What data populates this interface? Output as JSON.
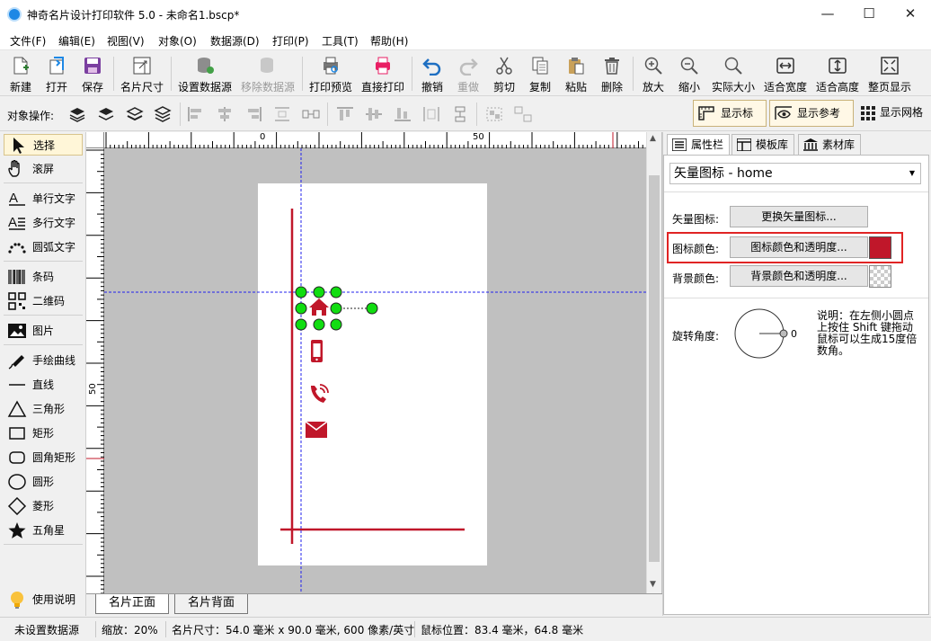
{
  "window": {
    "title": "神奇名片设计打印软件 5.0 - 未命名1.bscp*",
    "minimize": "—",
    "maximize": "☐",
    "close": "✕"
  },
  "menu": [
    "文件(F)",
    "编辑(E)",
    "视图(V)",
    "对象(O)",
    "数据源(D)",
    "打印(P)",
    "工具(T)",
    "帮助(H)"
  ],
  "toolbar": {
    "new": "新建",
    "open": "打开",
    "save": "保存",
    "card_size": "名片尺寸",
    "set_datasource": "设置数据源",
    "remove_datasource": "移除数据源",
    "print_preview": "打印预览",
    "direct_print": "直接打印",
    "undo": "撤销",
    "redo": "重做",
    "cut": "剪切",
    "copy": "复制",
    "paste": "粘贴",
    "delete": "删除",
    "zoom_in": "放大",
    "zoom_out": "缩小",
    "actual_size": "实际大小",
    "fit_width": "适合宽度",
    "fit_height": "适合高度",
    "full_page": "整页显示"
  },
  "objbar": {
    "label": "对象操作:",
    "show_ruler": "显示标尺",
    "show_guides": "显示参考线",
    "show_grid": "显示网格"
  },
  "tools": {
    "select": "选择",
    "pan": "滚屏",
    "single_text": "单行文字",
    "multi_text": "多行文字",
    "arc_text": "圆弧文字",
    "barcode": "条码",
    "qrcode": "二维码",
    "image": "图片",
    "freehand": "手绘曲线",
    "line": "直线",
    "triangle": "三角形",
    "rectangle": "矩形",
    "rounded_rect": "圆角矩形",
    "ellipse": "圆形",
    "diamond": "菱形",
    "star": "五角星",
    "help": "使用说明"
  },
  "ruler": {
    "h0": "0",
    "h50": "50",
    "v50": "50"
  },
  "page_tabs": {
    "front": "名片正面",
    "back": "名片背面"
  },
  "right_tabs": {
    "properties": "属性栏",
    "templates": "模板库",
    "materials": "素材库"
  },
  "properties": {
    "object_select": "矢量图标 - home",
    "vector_icon_label": "矢量图标:",
    "vector_icon_button": "更换矢量图标...",
    "icon_color_label": "图标颜色:",
    "icon_color_button": "图标颜色和透明度...",
    "icon_color_value": "#c0172a",
    "bg_color_label": "背景颜色:",
    "bg_color_button": "背景颜色和透明度...",
    "rotation_label": "旋转角度:",
    "rotation_value": "0",
    "note": "说明：在左侧小圆点上按住 Shift 键拖动鼠标可以生成15度倍数角。"
  },
  "status": {
    "datasource": "未设置数据源",
    "zoom": "缩放：20%",
    "card_size": "名片尺寸：54.0 毫米 x 90.0 毫米, 600 像素/英寸",
    "mouse_pos": "鼠标位置：83.4 毫米，64.8 毫米"
  }
}
